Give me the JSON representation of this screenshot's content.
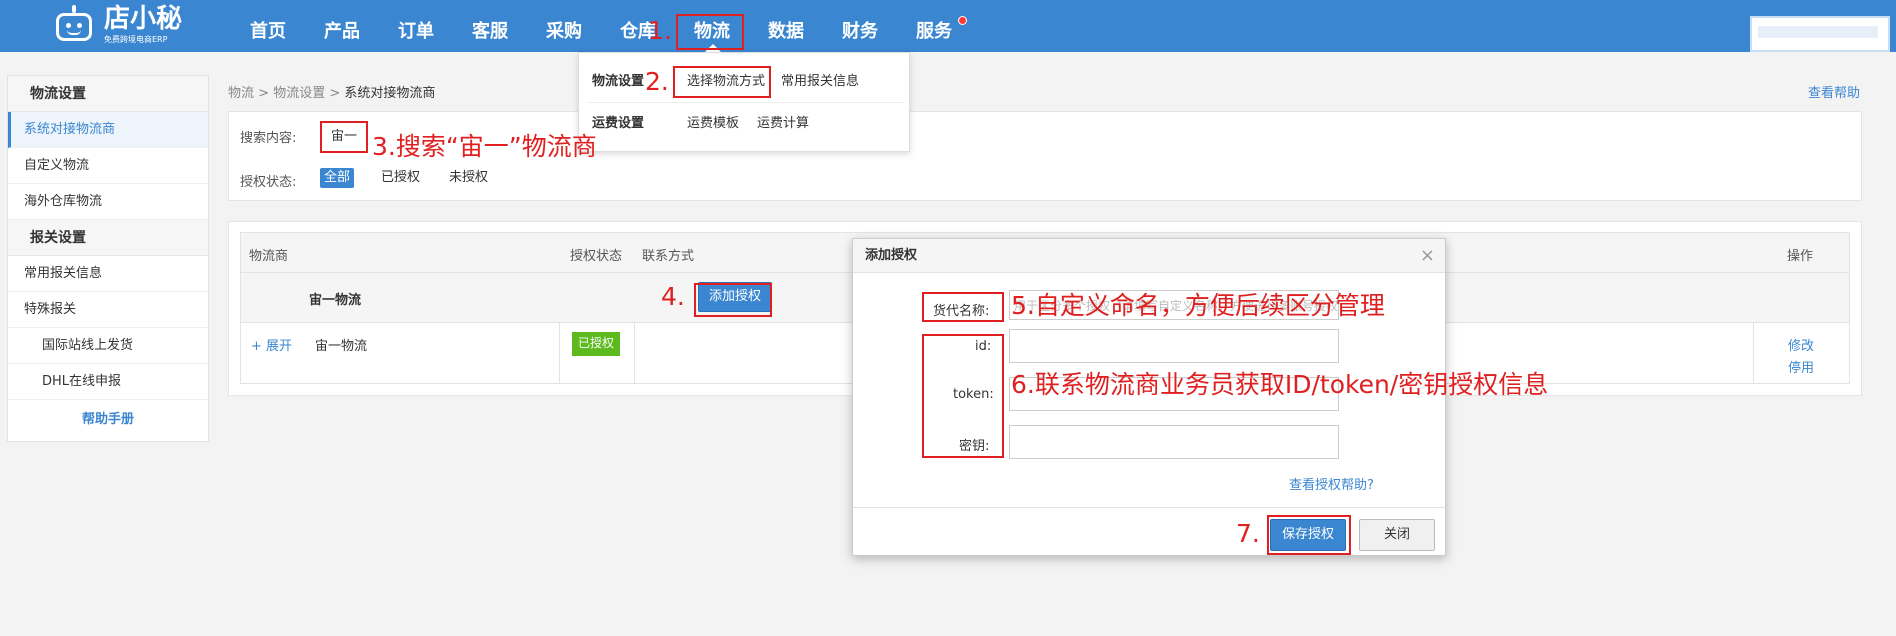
{
  "header": {
    "logo_title": "店小秘",
    "logo_subtitle": "免费跨境电商ERP",
    "nav": [
      "首页",
      "产品",
      "订单",
      "客服",
      "采购",
      "仓库",
      "物流",
      "数据",
      "财务",
      "服务"
    ],
    "active_nav": "物流",
    "colors": {
      "bar": "#3b86d1",
      "annotation": "#e02020"
    }
  },
  "dropdown": {
    "group1_title": "物流设置",
    "group1_items": [
      "选择物流方式",
      "常用报关信息"
    ],
    "group2_title": "运费设置",
    "group2_items": [
      "运费模板",
      "运费计算"
    ]
  },
  "sidebar": {
    "section1": "物流设置",
    "items1": [
      "系统对接物流商",
      "自定义物流",
      "海外仓库物流"
    ],
    "section2": "报关设置",
    "items2": [
      "常用报关信息",
      "特殊报关"
    ],
    "subitems2": [
      "国际站线上发货",
      "DHL在线申报"
    ],
    "help": "帮助手册"
  },
  "breadcrumb": {
    "p1": "物流",
    "p2": "物流设置",
    "current": "系统对接物流商",
    "sep": ">"
  },
  "help_link": "查看帮助",
  "search": {
    "label": "搜索内容:",
    "value": "宙一",
    "status_label": "授权状态:",
    "filters": [
      "全部",
      "已授权",
      "未授权"
    ]
  },
  "table": {
    "headers": {
      "provider": "物流商",
      "status": "授权状态",
      "contact": "联系方式",
      "ops": "操作"
    },
    "group_name": "宙一物流",
    "add_button": "添加授权",
    "row": {
      "expand": "+ 展开",
      "name": "宙一物流",
      "status": "已授权",
      "edit": "修改",
      "disable": "停用"
    }
  },
  "modal": {
    "title": "添加授权",
    "close": "×",
    "alias_label": "货代名称:",
    "alias_placeholder": "用于区分多个授权（请填写自定义名称，方便进行多账号授权管理）",
    "id_label": "id:",
    "token_label": "token:",
    "secret_label": "密钥:",
    "auth_help": "查看授权帮助?",
    "save": "保存授权",
    "cancel": "关闭"
  },
  "annotations": {
    "a1": "1.",
    "a2": "2.",
    "a3": "3.搜索“宙一”物流商",
    "a4": "4.",
    "a5": "5.自定义命名，方便后续区分管理",
    "a6": "6.联系物流商业务员获取ID/token/密钥授权信息",
    "a7": "7."
  }
}
